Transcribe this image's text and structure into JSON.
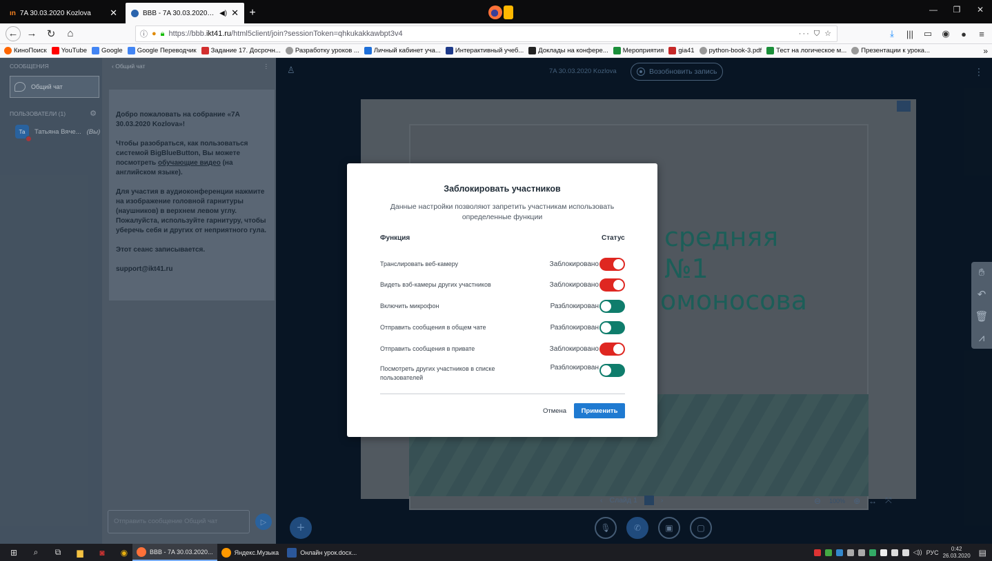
{
  "browser": {
    "tabs": [
      {
        "label": "7A 30.03.2020 Kozlova",
        "active": false
      },
      {
        "label": "BBB - 7A 30.03.2020 Kozlova",
        "active": true
      }
    ],
    "url_prefix": "https://bbb.",
    "url_host": "ikt41.ru",
    "url_path": "/html5client/join?sessionToken=qhkukakkawbpt3v4",
    "url_actions": "··· ⛉ ☆",
    "bookmarks": [
      {
        "label": "КиноПоиск",
        "color": "#ff6600"
      },
      {
        "label": "YouTube",
        "color": "#ff0000"
      },
      {
        "label": "Google",
        "color": "#4285f4"
      },
      {
        "label": "Google Переводчик",
        "color": "#4285f4"
      },
      {
        "label": "Задание 17. Досрочн...",
        "color": "#d32f2f"
      },
      {
        "label": "Разработку уроков ...",
        "color": "#777777"
      },
      {
        "label": "Личный кабинет уча...",
        "color": "#1e6fd9"
      },
      {
        "label": "Интерактивный учеб...",
        "color": "#1e3a8a"
      },
      {
        "label": "Доклады на конфере...",
        "color": "#222222"
      },
      {
        "label": "Мероприятия",
        "color": "#1b8f3a"
      },
      {
        "label": "gia41",
        "color": "#c62828"
      },
      {
        "label": "python-book-3.pdf",
        "color": "#777777"
      },
      {
        "label": "Тест на логическое м...",
        "color": "#1b8f3a"
      },
      {
        "label": "Презентации к урока...",
        "color": "#777777"
      }
    ]
  },
  "userlist": {
    "messages_heading": "СООБЩЕНИЯ",
    "public_chat": "Общий чат",
    "users_heading": "ПОЛЬЗОВАТЕЛИ (1)",
    "user_initials": "Та",
    "user_name": "Татьяна Вяче...",
    "user_you": "(Вы)"
  },
  "chat": {
    "header": "Общий чат",
    "welcome_title": "Добро пожаловать на собрание «7А 30.03.2020 Kozlova»!",
    "tutorial_pre": "Чтобы разобраться, как пользоваться системой BigBlueButton, Вы можете посмотреть ",
    "tutorial_link": "обучающие видео",
    "tutorial_post": " (на английском языке).",
    "audio_text": "Для участия в аудиоконференции нажмите на изображение головной гарнитуры (наушников) в верхнем левом углу. Пожалуйста, используйте гарнитуру, чтобы уберечь себя и других от неприятного гула.",
    "recording_text": "Этот сеанс записывается.",
    "support": "support@ikt41.ru",
    "input_placeholder": "Отправить сообщение Общий чат"
  },
  "main": {
    "meeting_title": "7A 30.03.2020 Kozlova",
    "record_label": "Возобновить запись",
    "slide_label": "Слайд 1",
    "zoom_percent": "100%",
    "slide_texts": [
      "средняя",
      "№1",
      "омоносова"
    ]
  },
  "modal": {
    "title": "Заблокировать участников",
    "description": "Данные настройки позволяют запретить участникам использовать определенные функции",
    "col_function": "Функция",
    "col_status": "Статус",
    "rows": [
      {
        "label": "Транслировать веб-камеру",
        "status": "Заблокировано",
        "locked": true
      },
      {
        "label": "Видеть вэб-камеры других участников",
        "status": "Заблокировано",
        "locked": true
      },
      {
        "label": "Включить микрофон",
        "status": "Разблокирован",
        "locked": false
      },
      {
        "label": "Отправить сообщения в общем чате",
        "status": "Разблокирован",
        "locked": false
      },
      {
        "label": "Отправить сообщения в привате",
        "status": "Заблокировано",
        "locked": true
      },
      {
        "label": "Посмотреть других участников в списке пользователей",
        "status": "Разблокирован",
        "locked": false
      }
    ],
    "cancel": "Отмена",
    "apply": "Применить"
  },
  "taskbar": {
    "apps": [
      {
        "label": "BBB - 7A 30.03.2020...",
        "active": true
      },
      {
        "label": "Яндекс.Музыка",
        "active": false
      },
      {
        "label": "Онлайн урок.docx...",
        "active": false
      }
    ],
    "lang": "РУС",
    "time": "0:42",
    "date": "26.03.2020"
  }
}
